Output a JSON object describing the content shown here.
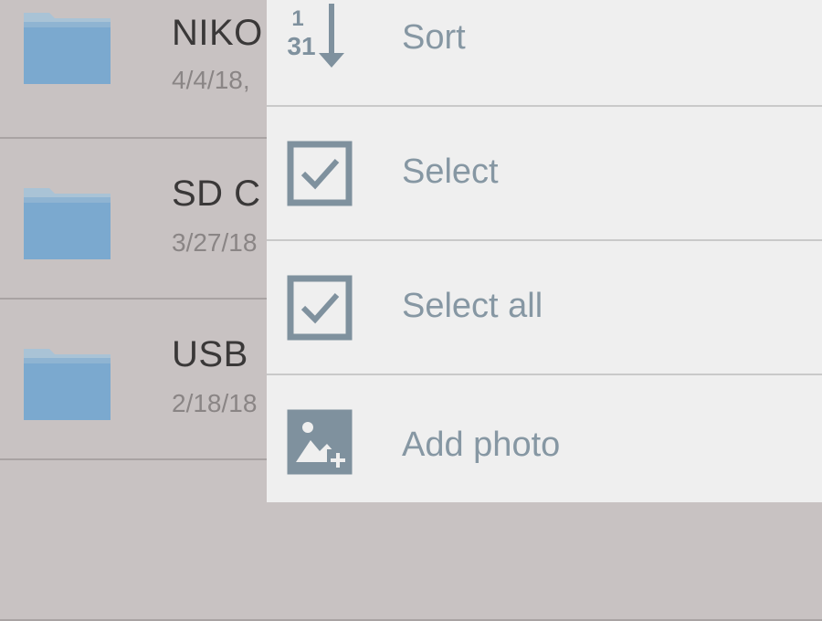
{
  "files": [
    {
      "name": "NIKO",
      "date": "4/4/18,",
      "icon": "folder-icon"
    },
    {
      "name": "SD C",
      "date": "3/27/18",
      "icon": "folder-icon"
    },
    {
      "name": "USB",
      "date": "2/18/18",
      "icon": "folder-icon"
    }
  ],
  "menu": {
    "sort": {
      "label": "Sort",
      "icon": "sort-icon",
      "icon_top": "1",
      "icon_bottom": "31"
    },
    "select": {
      "label": "Select",
      "icon": "checkbox-icon"
    },
    "select_all": {
      "label": "Select all",
      "icon": "checkbox-icon"
    },
    "add_photo": {
      "label": "Add photo",
      "icon": "add-photo-icon"
    }
  },
  "colors": {
    "folder": "#7ba9cf",
    "folder_tab": "#a9c3d6",
    "menu_accent": "#7f919e",
    "menu_background": "#efefef",
    "dim_background": "#c8c2c2"
  }
}
